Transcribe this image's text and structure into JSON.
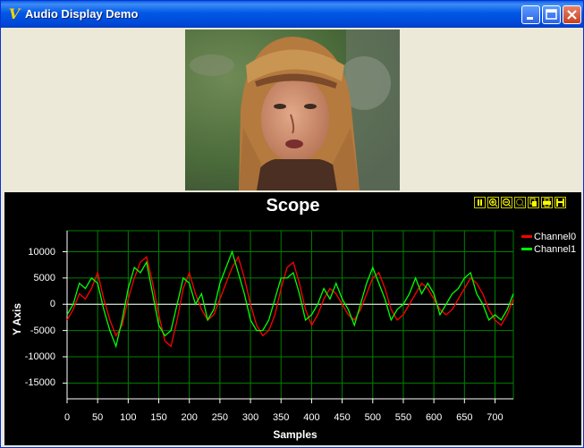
{
  "window": {
    "title": "Audio Display Demo",
    "icon": "app-v-icon",
    "controls": [
      "minimize-icon",
      "maximize-icon",
      "close-icon"
    ]
  },
  "video": {
    "description_icon": "video-frame-image"
  },
  "scope": {
    "title": "Scope",
    "toolbar": [
      "pause-icon",
      "zoom-in-icon",
      "zoom-out-icon",
      "zoom-fit-icon",
      "copy-icon",
      "print-icon",
      "save-icon"
    ]
  },
  "colors": {
    "channel0": "#ff0000",
    "channel1": "#00ff00",
    "grid": "#008000",
    "zero_line": "#ffffff"
  },
  "chart_data": {
    "type": "line",
    "title": "Scope",
    "xlabel": "Samples",
    "ylabel": "Y Axis",
    "xlim": [
      0,
      730
    ],
    "ylim": [
      -18000,
      14000
    ],
    "x_ticks": [
      0,
      50,
      100,
      150,
      200,
      250,
      300,
      350,
      400,
      450,
      500,
      550,
      600,
      650,
      700
    ],
    "y_ticks": [
      10000,
      5000,
      0,
      -5000,
      -10000,
      -15000
    ],
    "x_tick_labels": [
      "0",
      "50",
      "100",
      "150",
      "200",
      "250",
      "300",
      "350",
      "400",
      "450",
      "500",
      "550",
      "600",
      "650",
      "700"
    ],
    "y_tick_labels": [
      "10000",
      "5000",
      "0",
      "-5000",
      "-10000",
      "-15000"
    ],
    "grid": true,
    "legend": "right",
    "x_step": 10,
    "series": [
      {
        "name": "Channel0",
        "color": "#ff0000",
        "values": [
          -3000,
          -1000,
          2000,
          1000,
          3000,
          6000,
          1000,
          -3000,
          -6000,
          -4000,
          1000,
          5000,
          8000,
          9000,
          4000,
          -2000,
          -7000,
          -8000,
          -3000,
          3000,
          6000,
          2000,
          -1000,
          -3000,
          -2000,
          1000,
          4000,
          7000,
          9000,
          5000,
          0,
          -4000,
          -6000,
          -5000,
          -2000,
          3000,
          7000,
          8000,
          4000,
          -1000,
          -4000,
          -2000,
          1000,
          3000,
          2000,
          0,
          -2000,
          -3000,
          -1000,
          2000,
          5000,
          6000,
          3000,
          -1000,
          -3000,
          -2000,
          0,
          2000,
          4000,
          3000,
          1000,
          -1000,
          -2000,
          -1000,
          1000,
          3000,
          5000,
          4000,
          2000,
          -1000,
          -3000,
          -4000,
          -2000,
          1000
        ]
      },
      {
        "name": "Channel1",
        "color": "#00ff00",
        "values": [
          -2000,
          0,
          4000,
          3000,
          5000,
          4000,
          -1000,
          -5000,
          -8000,
          -3000,
          3000,
          7000,
          6000,
          8000,
          2000,
          -4000,
          -6000,
          -5000,
          0,
          5000,
          4000,
          0,
          2000,
          -3000,
          -1000,
          4000,
          7000,
          10000,
          6000,
          2000,
          -3000,
          -5000,
          -5000,
          -3000,
          1000,
          5000,
          5000,
          6000,
          2000,
          -3000,
          -2000,
          0,
          3000,
          1000,
          4000,
          1000,
          -1000,
          -4000,
          0,
          4000,
          7000,
          4000,
          1000,
          -3000,
          -1000,
          0,
          2000,
          5000,
          2000,
          4000,
          2000,
          -2000,
          0,
          2000,
          3000,
          5000,
          6000,
          2000,
          0,
          -3000,
          -2000,
          -3000,
          -1000,
          2000
        ]
      }
    ]
  }
}
